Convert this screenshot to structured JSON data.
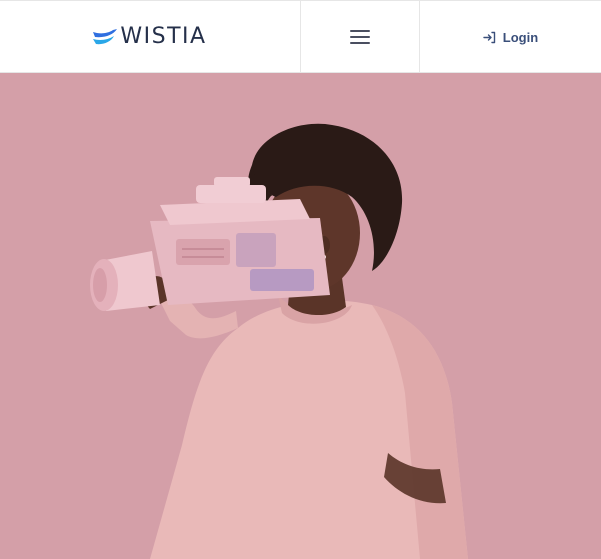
{
  "header": {
    "logo_text": "WISTIA",
    "menu_icon": "hamburger-menu-icon",
    "login_label": "Login",
    "login_icon": "login-arrow-icon"
  },
  "hero": {
    "background": "#d6a2ab",
    "image_description_icon": "hero-video-image"
  },
  "colors": {
    "brand_blue": "#2f6fe0",
    "text_dark": "#25304a",
    "login_blue": "#3a4f7a"
  }
}
